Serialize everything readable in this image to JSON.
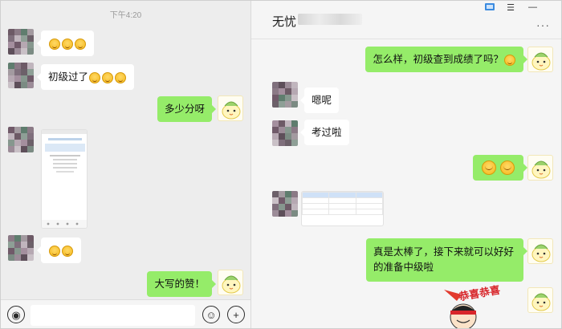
{
  "left_chat": {
    "timestamp": "下午4:20",
    "messages": [
      {
        "side": "left",
        "kind": "emoji",
        "text": "",
        "emoji_count": 3
      },
      {
        "side": "left",
        "kind": "text",
        "text": "初级过了",
        "emoji_count": 3
      },
      {
        "side": "right",
        "kind": "text",
        "text": "多少分呀"
      },
      {
        "side": "left",
        "kind": "screenshot"
      },
      {
        "side": "left",
        "kind": "emoji",
        "emoji_count": 2
      },
      {
        "side": "right",
        "kind": "text",
        "text": "大写的赞！"
      }
    ],
    "input": {
      "placeholder": ""
    },
    "icons": {
      "voice": "voice-icon",
      "emoji": "emoji-icon",
      "plus": "plus-icon"
    }
  },
  "right_chat": {
    "title": "无忧",
    "window_controls": {
      "pin": "pin-icon",
      "menu": "☰",
      "minimize": "—"
    },
    "more": "···",
    "messages": [
      {
        "side": "right",
        "kind": "text",
        "text": "怎么样，初级查到成绩了吗？"
      },
      {
        "side": "left",
        "kind": "text",
        "text": "嗯呢"
      },
      {
        "side": "left",
        "kind": "text",
        "text": "考过啦"
      },
      {
        "side": "right",
        "kind": "emoji",
        "emoji_count": 2
      },
      {
        "side": "left",
        "kind": "image"
      },
      {
        "side": "right",
        "kind": "text",
        "text": "真是太棒了，接下来就可以好好的准备中级啦"
      },
      {
        "side": "right",
        "kind": "sticker",
        "text": "恭喜恭喜"
      }
    ]
  },
  "colors": {
    "green_bubble": "#95ec69",
    "left_bg": "#ededed",
    "right_bg": "#f5f5f5"
  }
}
